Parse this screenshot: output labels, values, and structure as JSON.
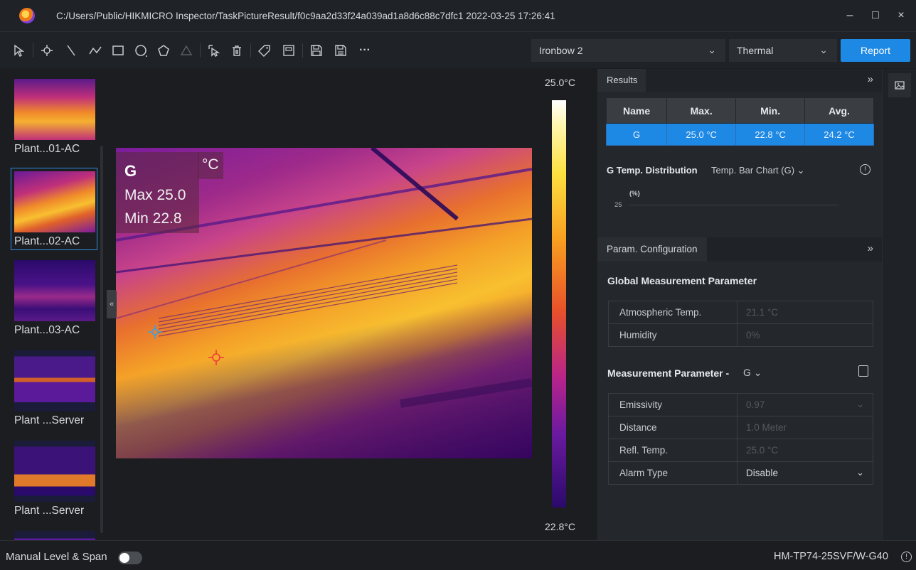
{
  "window": {
    "title": "C:/Users/Public/HIKMICRO Inspector/TaskPictureResult/f0c9aa2d33f24a039ad1a8d6c88c7dfc1 2022-03-25 17:26:41",
    "minimize": "–",
    "maximize": "□",
    "close": "×"
  },
  "toolbar": {
    "palette": "Ironbow 2",
    "mode": "Thermal",
    "report_label": "Report",
    "more": "···",
    "icons": [
      "select-icon",
      "point-icon",
      "line-icon",
      "polyline-icon",
      "rectangle-icon",
      "circle-icon",
      "polygon-icon",
      "triangle-icon",
      "cursor-edit-icon",
      "delete-icon",
      "tag-icon",
      "frame-icon",
      "save-icon",
      "save-as-icon",
      "more-icon"
    ]
  },
  "thumbnails": [
    {
      "label": "Plant...01-AC"
    },
    {
      "label": "Plant...02-AC"
    },
    {
      "label": "Plant...03-AC"
    },
    {
      "label": "Plant ...Server"
    },
    {
      "label": "Plant ...Server"
    }
  ],
  "collapse": "«",
  "image_overlay": {
    "name": "G",
    "unit": "°C",
    "max": "Max 25.0",
    "min": "Min 22.8"
  },
  "scale": {
    "top": "25.0°C",
    "bottom": "22.8°C"
  },
  "results": {
    "tab": "Results",
    "expand": "»",
    "headers": [
      "Name",
      "Max.",
      "Min.",
      "Avg."
    ],
    "rows": [
      [
        "G",
        "25.0 °C",
        "22.8 °C",
        "24.2 °C"
      ]
    ]
  },
  "distribution": {
    "title": "G Temp. Distribution",
    "chart_select": "Temp. Bar Chart (G)  ⌄",
    "y_unit": "(%)",
    "y_tick": "25"
  },
  "param_config": {
    "tab": "Param. Configuration",
    "expand": "»",
    "global_title": "Global Measurement Parameter",
    "global_rows": [
      {
        "key": "Atmospheric Temp.",
        "value": "21.1 °C"
      },
      {
        "key": "Humidity",
        "value": "0%"
      }
    ],
    "measure_title": "Measurement Parameter  -",
    "measure_target": "G  ⌄",
    "measure_rows": [
      {
        "key": "Emissivity",
        "value": "0.97",
        "chev": "⌄"
      },
      {
        "key": "Distance",
        "value": "1.0 Meter",
        "chev": ""
      },
      {
        "key": "Refl. Temp.",
        "value": "25.0 °C",
        "chev": ""
      },
      {
        "key": "Alarm Type",
        "value": "Disable",
        "chev": "⌄"
      }
    ]
  },
  "status": {
    "level_span_label": "Manual Level & Span",
    "level_span_on": false,
    "model": "HM-TP74-25SVF/W-G40"
  },
  "colors": {
    "accent": "#1e88e5",
    "background": "#1b1d21",
    "panel": "#24272c"
  }
}
